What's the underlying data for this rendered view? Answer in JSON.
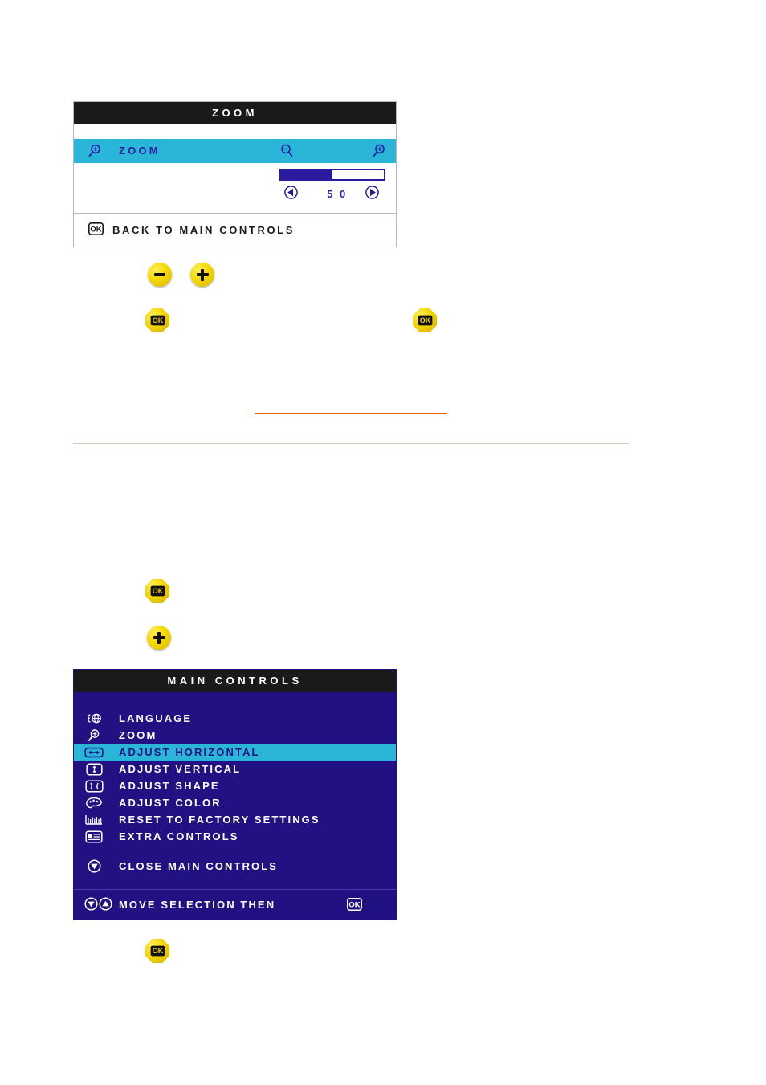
{
  "zoom_panel": {
    "title": "ZOOM",
    "row_label": "ZOOM",
    "icon_left": "magnifier-plus-icon",
    "icon_decrease": "magnifier-minus-icon",
    "icon_increase": "magnifier-plus-icon",
    "slider": {
      "value": "5 0",
      "value_number": 50,
      "min": 0,
      "max": 100,
      "fill_percent": 50,
      "left_arrow_icon": "arrow-left-icon",
      "right_arrow_icon": "arrow-right-icon",
      "fill_color": "#2a1a9e",
      "border_color": "#2a1a9e"
    },
    "back_row": {
      "icon": "ok-icon",
      "label": "BACK TO MAIN CONTROLS"
    },
    "colors": {
      "titlebar": "#1a1a1a",
      "highlight": "#29b6d8",
      "text_blue": "#2a1a9e",
      "background": "#ffffff"
    }
  },
  "bezel_buttons": {
    "minus": {
      "icon": "minus-icon",
      "name": "minus-button"
    },
    "plus": {
      "icon": "plus-icon",
      "name": "plus-button"
    },
    "ok": {
      "icon": "ok-icon",
      "name": "ok-button"
    }
  },
  "rules": {
    "orange_color": "#e8601c",
    "gray_color": "#cfcabd"
  },
  "main_controls_panel": {
    "title": "MAIN CONTROLS",
    "items": [
      {
        "icon": "language-globe-icon",
        "label": "LANGUAGE",
        "selected": false
      },
      {
        "icon": "magnifier-plus-icon",
        "label": "ZOOM",
        "selected": false
      },
      {
        "icon": "adjust-horizontal-icon",
        "label": "ADJUST HORIZONTAL",
        "selected": true
      },
      {
        "icon": "adjust-vertical-icon",
        "label": "ADJUST VERTICAL",
        "selected": false
      },
      {
        "icon": "adjust-shape-icon",
        "label": "ADJUST SHAPE",
        "selected": false
      },
      {
        "icon": "color-palette-icon",
        "label": "ADJUST COLOR",
        "selected": false
      },
      {
        "icon": "reset-factory-icon",
        "label": "RESET TO FACTORY SETTINGS",
        "selected": false
      },
      {
        "icon": "extra-controls-icon",
        "label": "EXTRA CONTROLS",
        "selected": false
      }
    ],
    "close_item": {
      "icon": "close-down-arrow-icon",
      "label": "CLOSE MAIN CONTROLS"
    },
    "footer": {
      "icon_down": "arrow-down-circle-icon",
      "icon_up": "arrow-up-circle-icon",
      "label": "MOVE SELECTION THEN",
      "ok_icon": "ok-icon"
    },
    "colors": {
      "background": "#221183",
      "titlebar": "#1a1a1a",
      "highlight": "#29b6d8",
      "text": "#ffffff"
    }
  }
}
